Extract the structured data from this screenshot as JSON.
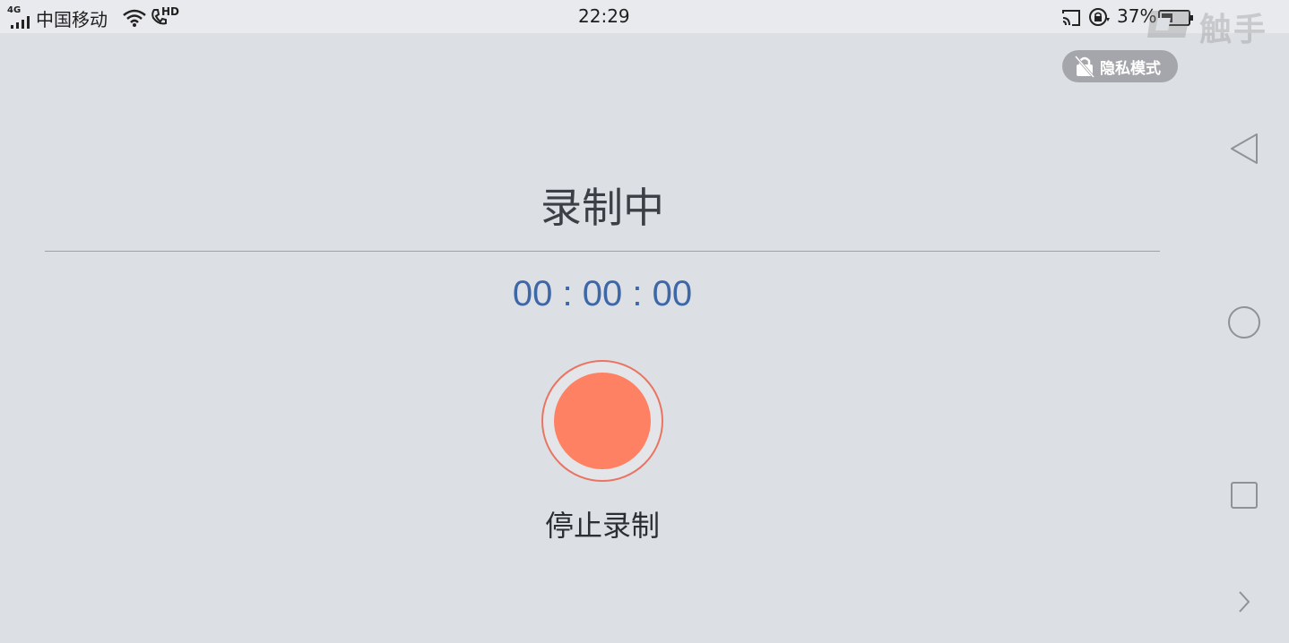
{
  "status_bar": {
    "network": "4G",
    "carrier": "中国移动",
    "hd_badge": "HD",
    "time": "22:29",
    "battery_percent": "37%",
    "icons": [
      "signal-icon",
      "wifi-icon",
      "volte-call-icon",
      "cast-icon",
      "rotation-lock-icon",
      "battery-icon"
    ]
  },
  "watermark": "触手",
  "privacy_mode": {
    "label": "隐私模式",
    "icon": "privacy-lock-off-icon"
  },
  "recording": {
    "title": "录制中",
    "timer": "00 : 00 : 00",
    "stop_label": "停止录制",
    "accent_color": "#ff8163",
    "timer_color": "#3e67a8"
  },
  "nav_bar": {
    "buttons": [
      "back-icon",
      "home-icon",
      "recents-icon",
      "expand-icon"
    ]
  }
}
